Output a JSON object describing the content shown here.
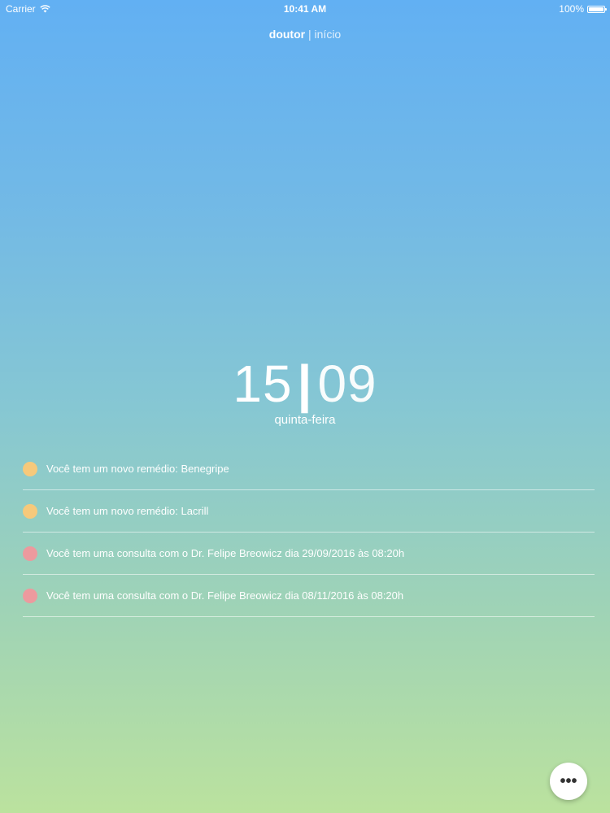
{
  "status_bar": {
    "carrier": "Carrier",
    "time": "10:41 AM",
    "battery": "100%"
  },
  "nav": {
    "app_name": "doutor",
    "separator": "|",
    "page": "início"
  },
  "date": {
    "day": "15",
    "separator": "|",
    "month": "09",
    "weekday": "quinta-feira"
  },
  "notifications": [
    {
      "text": "Você tem um novo remédio: Benegripe",
      "color": "#f6c97b"
    },
    {
      "text": "Você tem um novo remédio: Lacrill",
      "color": "#f6c97b"
    },
    {
      "text": "Você tem uma consulta com o Dr. Felipe Breowicz dia 29/09/2016 às 08:20h",
      "color": "#ec9a9e"
    },
    {
      "text": "Você tem uma consulta com o Dr. Felipe Breowicz dia 08/11/2016 às 08:20h",
      "color": "#ec9a9e"
    }
  ],
  "fab": {
    "icon": "more-icon",
    "glyph": "•••"
  }
}
